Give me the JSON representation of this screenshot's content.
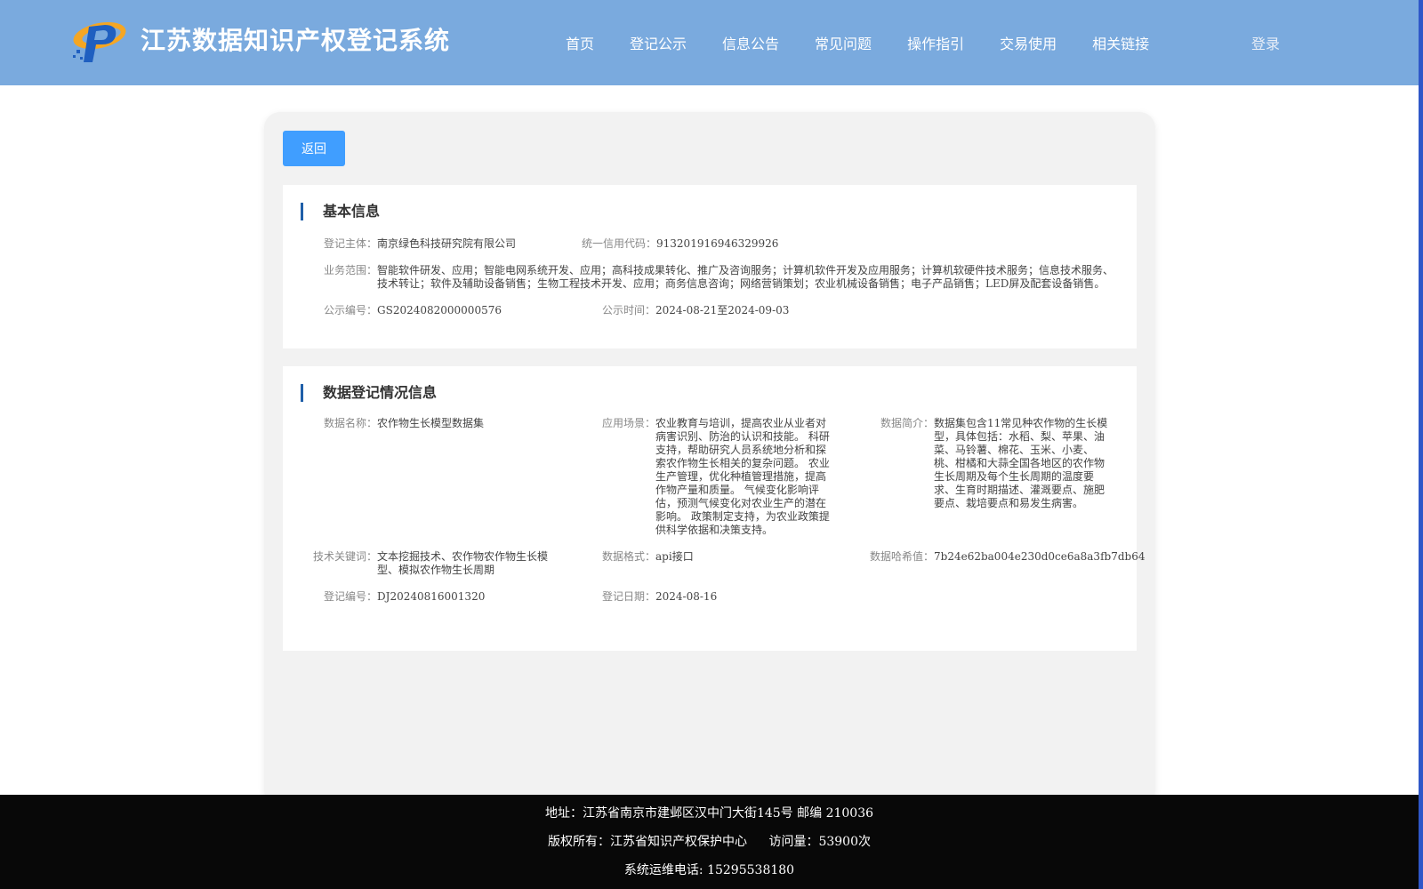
{
  "header": {
    "title": "江苏数据知识产权登记系统",
    "nav": [
      "首页",
      "登记公示",
      "信息公告",
      "常见问题",
      "操作指引",
      "交易使用",
      "相关链接"
    ],
    "login_label": "登录",
    "colors": {
      "header_bg": "#7aaade",
      "button": "#409eff",
      "accent_bar": "#1f5fa8",
      "footer_bg": "#080808"
    }
  },
  "back_label": "返回",
  "basic": {
    "title": "基本信息",
    "subject_label": "登记主体：",
    "subject": "南京绿色科技研究院有限公司",
    "credit_label": "统一信用代码：",
    "credit": "913201916946329926",
    "scope_label": "业务范围：",
    "scope": "智能软件研发、应用；智能电网系统开发、应用；高科技成果转化、推广及咨询服务；计算机软件开发及应用服务；计算机软硬件技术服务；信息技术服务、技术转让；软件及辅助设备销售；生物工程技术开发、应用；商务信息咨询；网络营销策划；农业机械设备销售；电子产品销售；LED屏及配套设备销售。",
    "pub_no_label": "公示编号：",
    "pub_no": "GS2024082000000576",
    "pub_time_label": "公示时间：",
    "pub_time": "2024-08-21至2024-09-03"
  },
  "data_reg": {
    "title": "数据登记情况信息",
    "name_label": "数据名称：",
    "name": "农作物生长模型数据集",
    "scene_label": "应用场景：",
    "scene": "农业教育与培训，提高农业从业者对病害识别、防治的认识和技能。 科研支持，帮助研究人员系统地分析和探索农作物生长相关的复杂问题。 农业生产管理，优化种植管理措施，提高作物产量和质量。 气候变化影响评估，预测气候变化对农业生产的潜在影响。 政策制定支持，为农业政策提供科学依据和决策支持。",
    "intro_label": "数据简介：",
    "intro": "数据集包含11常见种农作物的生长模型，具体包括：水稻、梨、苹果、油菜、马铃薯、棉花、玉米、小麦、桃、柑橘和大蒜全国各地区的农作物生长周期及每个生长周期的温度要求、生育时期描述、灌溉要点、施肥要点、栽培要点和易发生病害。",
    "keywords_label": "技术关键词：",
    "keywords": "文本挖掘技术、农作物农作物生长模型、模拟农作物生长周期",
    "format_label": "数据格式：",
    "format": "api接口",
    "hash_label": "数据哈希值：",
    "hash": "7b24e62ba004e230d0ce6a8a3fb7db64",
    "reg_no_label": "登记编号：",
    "reg_no": "DJ20240816001320",
    "reg_date_label": "登记日期：",
    "reg_date": "2024-08-16"
  },
  "footer": {
    "address": "地址：江苏省南京市建邺区汉中门大街145号 邮编 210036",
    "copyright": "版权所有：江苏省知识产权保护中心",
    "visits": "访问量：53900次",
    "phone": "系统运维电话: 15295538180"
  }
}
